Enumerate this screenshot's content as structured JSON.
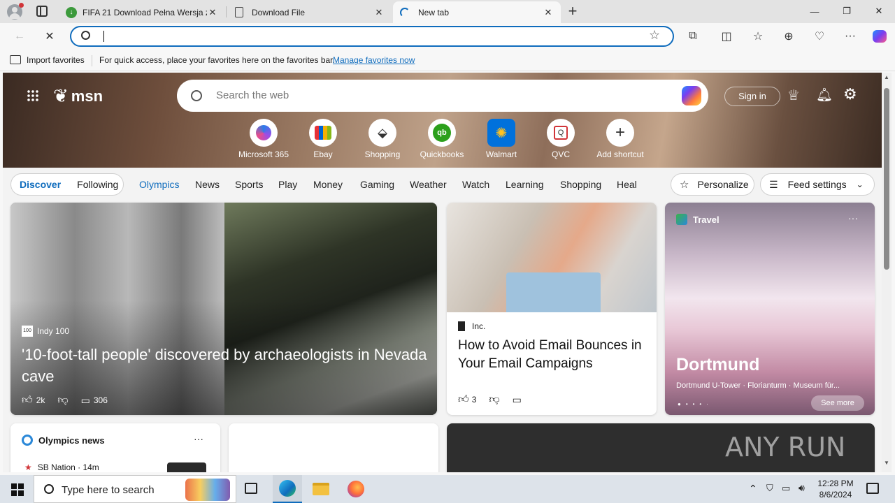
{
  "tabs": [
    {
      "title": "FIFA 21 Download Pełna Wersja z",
      "icon": "download-site-icon"
    },
    {
      "title": "Download File",
      "icon": "file-icon"
    },
    {
      "title": "New tab",
      "icon": "loading-spinner-icon"
    }
  ],
  "favorites_bar": {
    "import_label": "Import favorites",
    "message": "For quick access, place your favorites here on the favorites bar.",
    "manage_link": "Manage favorites now"
  },
  "msn": {
    "logo_text": "msn",
    "search_placeholder": "Search the web",
    "sign_in": "Sign in",
    "shortcuts": [
      {
        "label": "Microsoft 365",
        "icon": "microsoft365-icon"
      },
      {
        "label": "Ebay",
        "icon": "ebay-icon"
      },
      {
        "label": "Shopping",
        "icon": "shopping-tag-icon"
      },
      {
        "label": "Quickbooks",
        "icon": "quickbooks-icon"
      },
      {
        "label": "Walmart",
        "icon": "walmart-icon"
      },
      {
        "label": "QVC",
        "icon": "qvc-icon"
      },
      {
        "label": "Add shortcut",
        "icon": "plus-icon"
      }
    ],
    "feed_tabs": {
      "discover": "Discover",
      "following": "Following"
    },
    "categories": [
      "Olympics",
      "News",
      "Sports",
      "Play",
      "Money",
      "Gaming",
      "Weather",
      "Watch",
      "Learning",
      "Shopping",
      "Heal"
    ],
    "personalize": "Personalize",
    "feed_settings": "Feed settings"
  },
  "cards": {
    "main": {
      "source": "Indy 100",
      "headline": "'10-foot-tall people' discovered by archaeologists in Nevada cave",
      "likes": "2k",
      "comments": "306"
    },
    "inc": {
      "source": "Inc.",
      "headline": "How to Avoid Email Bounces in Your Email Campaigns",
      "likes": "3"
    },
    "travel": {
      "label": "Travel",
      "city": "Dortmund",
      "sub": "Dortmund U-Tower · Florianturm · Museum für...",
      "see_more": "See more"
    },
    "olympics": {
      "title": "Olympics news",
      "source": "SB Nation · 14m"
    }
  },
  "watermark": "ANY RUN",
  "taskbar": {
    "search_placeholder": "Type here to search",
    "time": "12:28 PM",
    "date": "8/6/2024"
  },
  "colors": {
    "accent": "#0f6cbd",
    "taskbar": "#dde3ea"
  }
}
